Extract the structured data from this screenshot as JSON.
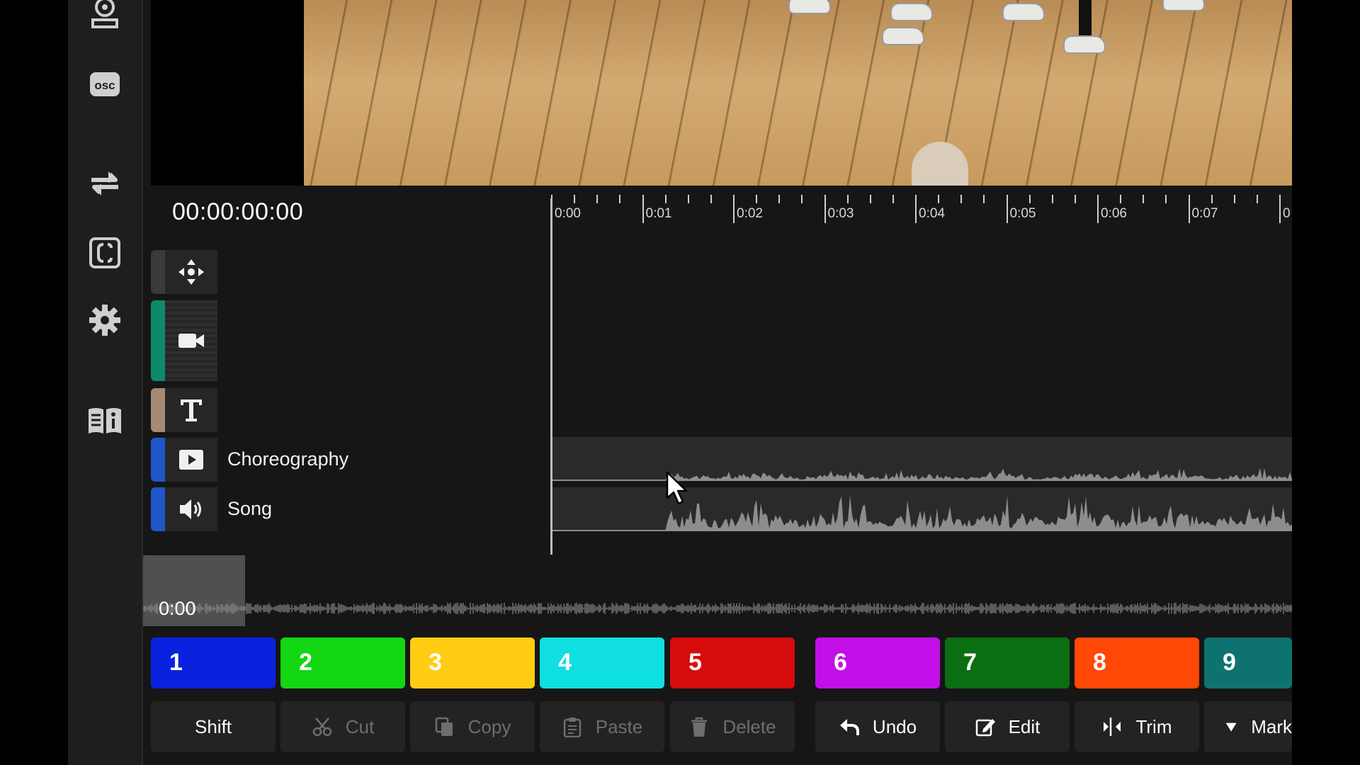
{
  "timecode": "00:00:00:00",
  "ruler_labels": [
    "0:00",
    "0:01",
    "0:02",
    "0:03",
    "0:04",
    "0:05",
    "0:06",
    "0:07",
    "0"
  ],
  "sidebar": {
    "items": [
      {
        "name": "recorder-icon"
      },
      {
        "name": "osc",
        "label": "osc"
      },
      {
        "name": "swap-arrows-icon"
      },
      {
        "name": "bracket-icon"
      },
      {
        "name": "gear-icon"
      },
      {
        "name": "manual-book-icon"
      }
    ]
  },
  "tracks": [
    {
      "icon": "move-arrows-icon",
      "color": "#3a3a3a",
      "label": ""
    },
    {
      "icon": "video-camera-icon",
      "color": "#0d8a6a",
      "label": ""
    },
    {
      "icon": "text-t-icon",
      "color": "#a58a74",
      "label": ""
    },
    {
      "icon": "play-box-icon",
      "color": "#1f57c9",
      "label": "Choreography"
    },
    {
      "icon": "speaker-icon",
      "color": "#1f57c9",
      "label": "Song"
    }
  ],
  "overview": {
    "time": "0:00"
  },
  "markers": [
    {
      "label": "1",
      "color": "#0a22e0"
    },
    {
      "label": "2",
      "color": "#12d712"
    },
    {
      "label": "3",
      "color": "#ffcc12"
    },
    {
      "label": "4",
      "color": "#0fdfe0"
    },
    {
      "label": "5",
      "color": "#d60c0c"
    },
    {
      "label": "6",
      "color": "#c20fe8"
    },
    {
      "label": "7",
      "color": "#0c6e12"
    },
    {
      "label": "8",
      "color": "#ff4706"
    },
    {
      "label": "9",
      "color": "#0e7370"
    }
  ],
  "actions": [
    {
      "label": "Shift",
      "icon": "",
      "enabled": true
    },
    {
      "label": "Cut",
      "icon": "scissors-icon",
      "enabled": false
    },
    {
      "label": "Copy",
      "icon": "copy-icon",
      "enabled": false
    },
    {
      "label": "Paste",
      "icon": "clipboard-icon",
      "enabled": false
    },
    {
      "label": "Delete",
      "icon": "trash-icon",
      "enabled": false
    },
    {
      "label": "Undo",
      "icon": "undo-arrow-icon",
      "enabled": true
    },
    {
      "label": "Edit",
      "icon": "edit-pencil-icon",
      "enabled": true
    },
    {
      "label": "Trim",
      "icon": "trim-icon",
      "enabled": true
    },
    {
      "label": "Mark",
      "icon": "marker-triangle-icon",
      "enabled": true
    }
  ]
}
